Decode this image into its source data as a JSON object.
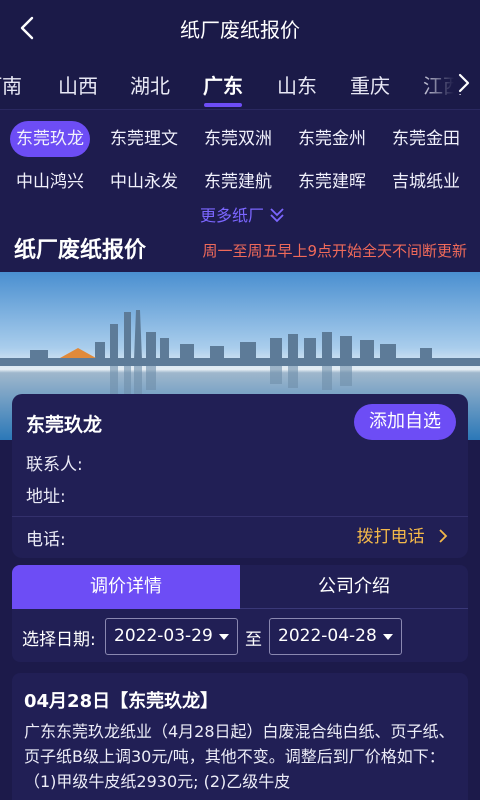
{
  "header": {
    "title": "纸厂废纸报价"
  },
  "provinces": {
    "items": [
      "河南",
      "山西",
      "湖北",
      "广东",
      "山东",
      "重庆",
      "江西"
    ],
    "active": "广东"
  },
  "mills": {
    "row1": [
      "东莞玖龙",
      "东莞理文",
      "东莞双洲",
      "东莞金州",
      "东莞金田"
    ],
    "row2": [
      "中山鸿兴",
      "中山永发",
      "东莞建航",
      "东莞建晖",
      "吉城纸业"
    ],
    "more_label": "更多纸厂"
  },
  "section": {
    "title": "纸厂废纸报价",
    "note": "周一至周五早上9点开始全天不间断更新"
  },
  "company_card": {
    "name": "东莞玖龙",
    "add_label": "添加自选",
    "contact_label": "联系人:",
    "address_label": "地址:",
    "phone_label": "电话:",
    "dial_label": "拨打电话"
  },
  "tabs": {
    "active": "调价详情",
    "inactive": "公司介绍"
  },
  "date_filter": {
    "label": "选择日期:",
    "start": "2022-03-29",
    "to": "至",
    "end": "2022-04-28"
  },
  "news": {
    "title": "04月28日【东莞玖龙】",
    "body": "广东东莞玖龙纸业（4月28日起）白废混合纯白纸、页子纸、页子纸B级上调30元/吨，其他不变。调整后到厂价格如下：（1)甲级牛皮纸2930元; (2)乙级牛皮"
  },
  "colors": {
    "accent": "#6d4df5",
    "background": "#1c1a4a",
    "note_red": "#f06a5a",
    "dial_orange": "#f3b84a"
  }
}
